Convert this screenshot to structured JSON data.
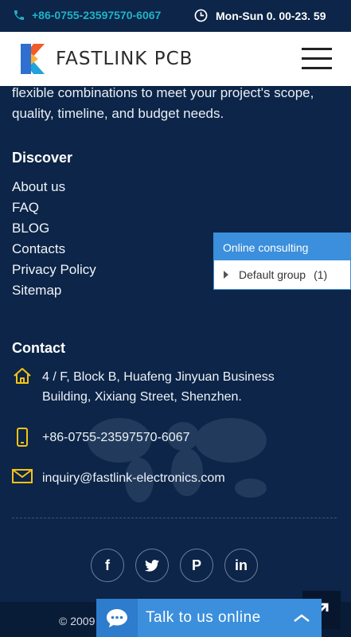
{
  "topbar": {
    "phone": "+86-0755-23597570-6067",
    "hours": "Mon-Sun 0. 00-23. 59"
  },
  "header": {
    "logo_text": "FASTLINK PCB"
  },
  "intro": "flexible combinations to meet your project's scope, quality, timeline, and budget needs.",
  "discover": {
    "title": "Discover",
    "links": [
      "About us",
      "FAQ",
      "BLOG",
      "Contacts",
      "Privacy Policy",
      "Sitemap"
    ]
  },
  "contact": {
    "title": "Contact",
    "address": "4 / F, Block B, Huafeng Jinyuan Business Building, Xixiang Street, Shenzhen.",
    "phone": "+86-0755-23597570-6067",
    "email": "inquiry@fastlink-electronics.com"
  },
  "socials": [
    {
      "icon": "facebook-icon",
      "glyph": "f"
    },
    {
      "icon": "twitter-icon",
      "glyph": ""
    },
    {
      "icon": "pinterest-icon",
      "glyph": "P"
    },
    {
      "icon": "linkedin-icon",
      "glyph": "in"
    }
  ],
  "footer": {
    "copyright": "© 2009"
  },
  "consult_popup": {
    "title": "Online consulting",
    "group_label": "Default group",
    "group_count": "(1)"
  },
  "chat": {
    "label": "Talk to us online"
  },
  "colors": {
    "background": "#0c2548",
    "accent": "#3b8fdc",
    "phone_text": "#1fb3c7",
    "icon_yellow": "#f4c316"
  }
}
